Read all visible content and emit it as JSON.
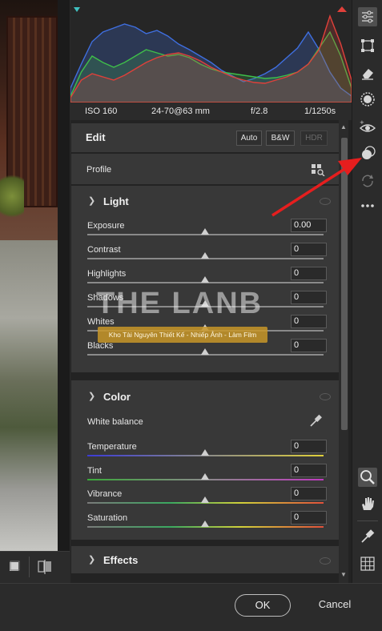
{
  "exif": {
    "iso": "ISO 160",
    "lens": "24-70@63 mm",
    "aperture": "f/2.8",
    "shutter": "1/1250s"
  },
  "edit": {
    "title": "Edit",
    "auto_label": "Auto",
    "bw_label": "B&W",
    "hdr_label": "HDR",
    "profile_label": "Profile"
  },
  "light": {
    "title": "Light",
    "sliders": [
      {
        "label": "Exposure",
        "value": "0.00"
      },
      {
        "label": "Contrast",
        "value": "0"
      },
      {
        "label": "Highlights",
        "value": "0"
      },
      {
        "label": "Shadows",
        "value": "0"
      },
      {
        "label": "Whites",
        "value": "0"
      },
      {
        "label": "Blacks",
        "value": "0"
      }
    ]
  },
  "color": {
    "title": "Color",
    "white_balance_label": "White balance",
    "sliders": [
      {
        "label": "Temperature",
        "value": "0"
      },
      {
        "label": "Tint",
        "value": "0"
      },
      {
        "label": "Vibrance",
        "value": "0"
      },
      {
        "label": "Saturation",
        "value": "0"
      }
    ]
  },
  "effects": {
    "title": "Effects"
  },
  "watermark": {
    "brand": "THE LANB",
    "tagline": "Kho Tài Nguyên Thiết Kế - Nhiếp Ảnh - Làm Film"
  },
  "buttons": {
    "ok": "OK",
    "cancel": "Cancel"
  },
  "colors": {
    "histogram_red": "#e0403a",
    "histogram_green": "#3fbf4a",
    "histogram_blue": "#3f6fe0",
    "arrow_red": "#e61e1e",
    "watermark_band": "#c8962a"
  },
  "tool_icons": [
    "sliders-icon",
    "crop-icon",
    "eraser-icon",
    "masking-icon",
    "red-eye-icon",
    "presets-icon",
    "snapshot-icon",
    "more-icon",
    "zoom-icon",
    "hand-icon",
    "color-sampler-icon",
    "grid-icon"
  ]
}
